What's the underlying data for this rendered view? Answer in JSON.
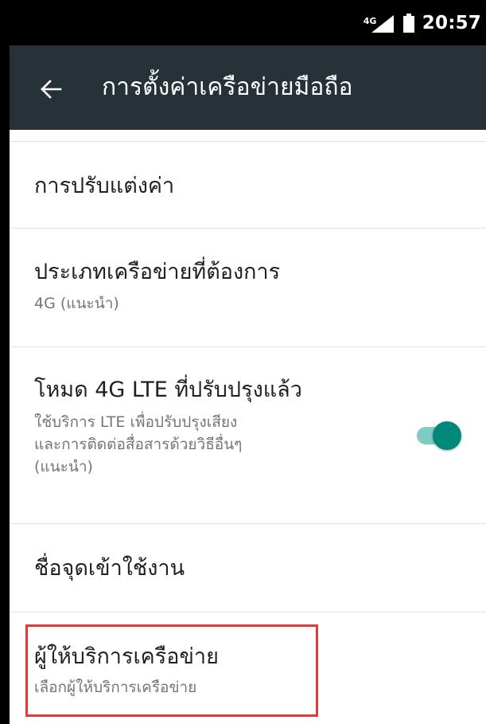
{
  "status_bar": {
    "network_type": "4G",
    "time": "20:57"
  },
  "app_bar": {
    "title": "การตั้งค่าเครือข่ายมือถือ"
  },
  "list": {
    "items": [
      {
        "title": "การปรับแต่งค่า"
      },
      {
        "title": "ประเภทเครือข่ายที่ต้องการ",
        "subtitle": "4G (แนะนำ)"
      },
      {
        "title": "โหมด 4G LTE ที่ปรับปรุงแล้ว",
        "subtitle": "ใช้บริการ LTE เพื่อปรับปรุงเสียง\nและการติดต่อสื่อสารด้วยวิธีอื่นๆ\n(แนะนำ)",
        "toggle_on": true
      },
      {
        "title": "ชื่อจุดเข้าใช้งาน"
      },
      {
        "title": "ผู้ให้บริการเครือข่าย",
        "subtitle": "เลือกผู้ให้บริการเครือข่าย"
      }
    ]
  },
  "colors": {
    "app_bar": "#263238",
    "accent": "#00897b",
    "highlight": "#e53935"
  },
  "icons": {
    "back": "back-arrow-icon",
    "signal": "signal-icon",
    "battery": "battery-icon"
  }
}
